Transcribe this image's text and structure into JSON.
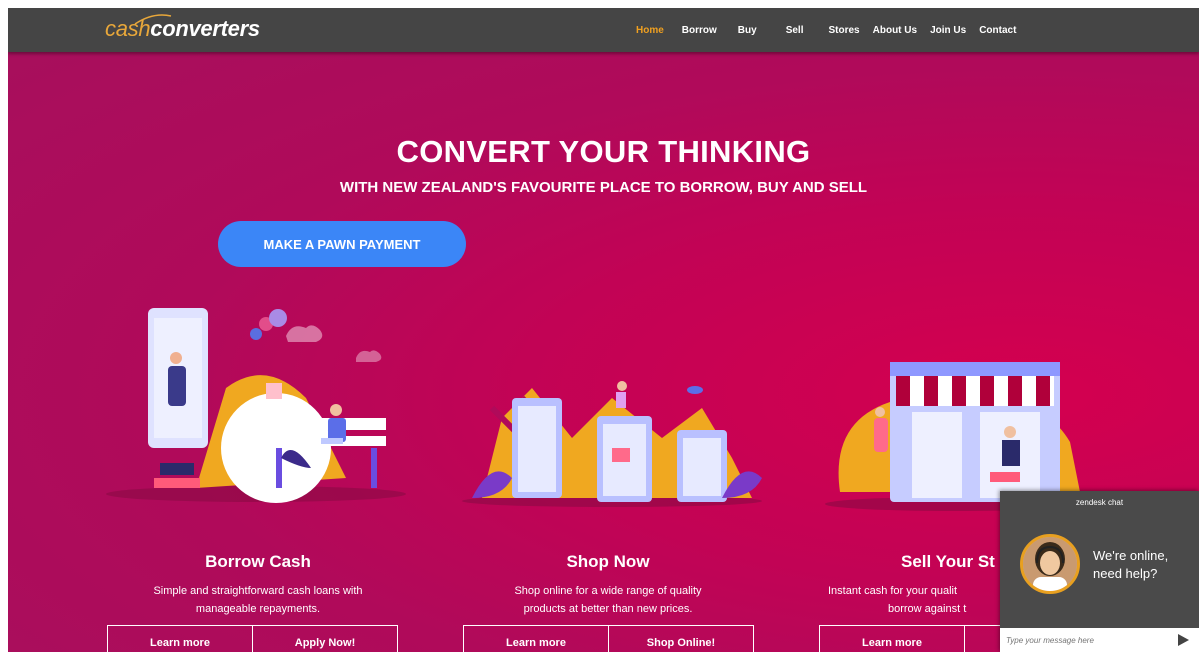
{
  "logo": {
    "part1": "cash",
    "part2": "converters"
  },
  "nav": {
    "items": [
      {
        "label": "Home",
        "active": true
      },
      {
        "label": "Borrow"
      },
      {
        "label": "Buy"
      },
      {
        "label": "Sell"
      },
      {
        "label": "Stores"
      },
      {
        "label": "About Us"
      },
      {
        "label": "Join Us"
      },
      {
        "label": "Contact"
      }
    ]
  },
  "hero": {
    "title": "CONVERT YOUR THINKING",
    "subtitle": "WITH NEW ZEALAND'S FAVOURITE PLACE TO BORROW, BUY AND SELL",
    "pawn_button": "MAKE A PAWN PAYMENT"
  },
  "cards": [
    {
      "title": "Borrow Cash",
      "desc_line1": "Simple and straightforward cash loans with",
      "desc_line2": "manageable repayments.",
      "btn1": "Learn more",
      "btn2": "Apply Now!"
    },
    {
      "title": "Shop Now",
      "desc_line1": "Shop online for a wide range of quality",
      "desc_line2": "products at better than new prices.",
      "btn1": "Learn more",
      "btn2": "Shop Online!"
    },
    {
      "title": "Sell Your St",
      "desc_line1": "Instant cash for your qualit",
      "desc_line2": "borrow against t",
      "btn1": "Learn more",
      "btn2": ""
    }
  ],
  "chat": {
    "header": "zendesk chat",
    "message_line1": "We're online,",
    "message_line2": "need help?",
    "placeholder": "Type your message here"
  },
  "colors": {
    "accent": "#e8a73a",
    "nav_bg": "#454545",
    "hero_bg": "#c20355",
    "button_blue": "#3b86f7"
  }
}
